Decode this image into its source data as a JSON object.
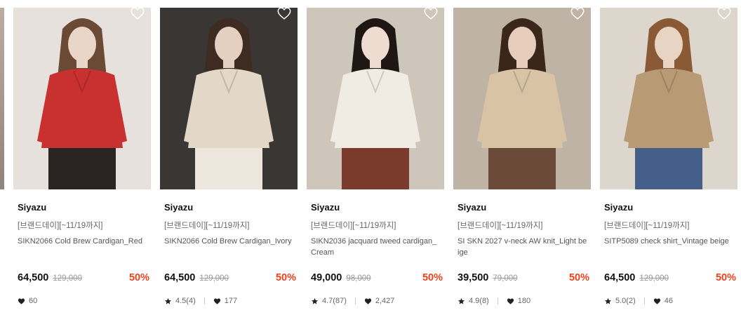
{
  "products": [
    {
      "brand": "Siyazu",
      "promo": "[브랜드데이][~11/19까지]",
      "name": "SIKN2066 Cold Brew Cardigan_Red",
      "price": "64,500",
      "original_price": "129,000",
      "discount": "50%",
      "rating": "",
      "likes": "60",
      "colors": {
        "bg": "#e6e1dc",
        "garment": "#c93030",
        "hair": "#6a4a34",
        "skin": "#ead6c8",
        "bottom": "#2a2522"
      }
    },
    {
      "brand": "Siyazu",
      "promo": "[브랜드데이][~11/19까지]",
      "name": "SIKN2066 Cold Brew Cardigan_Ivory",
      "price": "64,500",
      "original_price": "129,000",
      "discount": "50%",
      "rating": "4.5(4)",
      "likes": "177",
      "colors": {
        "bg": "#3a3633",
        "garment": "#e3d7c8",
        "hair": "#3e2c22",
        "skin": "#e4cfc0",
        "bottom": "#ece6dc"
      }
    },
    {
      "brand": "Siyazu",
      "promo": "[브랜드데이][~11/19까지]",
      "name": "SIKN2036 jacquard tweed cardigan_Cream",
      "price": "49,000",
      "original_price": "98,000",
      "discount": "50%",
      "rating": "4.7(87)",
      "likes": "2,427",
      "colors": {
        "bg": "#cfc6bb",
        "garment": "#f1ece3",
        "hair": "#1e1714",
        "skin": "#efdcd0",
        "bottom": "#7a3a2c"
      }
    },
    {
      "brand": "Siyazu",
      "promo": "[브랜드데이][~11/19까지]",
      "name": "SI SKN 2027 v-neck AW knit_Light beige",
      "price": "39,500",
      "original_price": "79,000",
      "discount": "50%",
      "rating": "4.9(8)",
      "likes": "180",
      "colors": {
        "bg": "#bfb3a6",
        "garment": "#d8c3a5",
        "hair": "#3b261c",
        "skin": "#e6cdbb",
        "bottom": "#6b4a3a"
      }
    },
    {
      "brand": "Siyazu",
      "promo": "[브랜드데이][~11/19까지]",
      "name": "SITP5089 check shirt_Vintage beige",
      "price": "64,500",
      "original_price": "129,000",
      "discount": "50%",
      "rating": "5.0(2)",
      "likes": "46",
      "colors": {
        "bg": "#ddd6cc",
        "garment": "#b89a74",
        "hair": "#8a5a36",
        "skin": "#e9d3c2",
        "bottom": "#44608a"
      }
    }
  ]
}
